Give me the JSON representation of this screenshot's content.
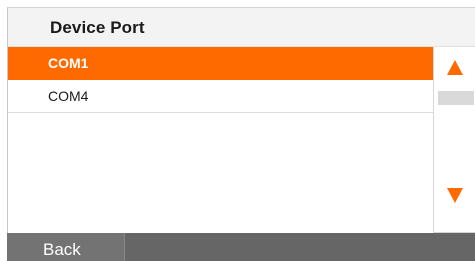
{
  "header": {
    "title": "Device Port"
  },
  "ports": [
    {
      "label": "COM1",
      "selected": true
    },
    {
      "label": "COM4",
      "selected": false
    }
  ],
  "scrollbar": {
    "up_icon": "arrow-up-icon",
    "down_icon": "arrow-down-icon"
  },
  "footer": {
    "back_label": "Back"
  },
  "colors": {
    "accent": "#ff6a00",
    "footer": "#666666",
    "header": "#f3f3f3"
  }
}
